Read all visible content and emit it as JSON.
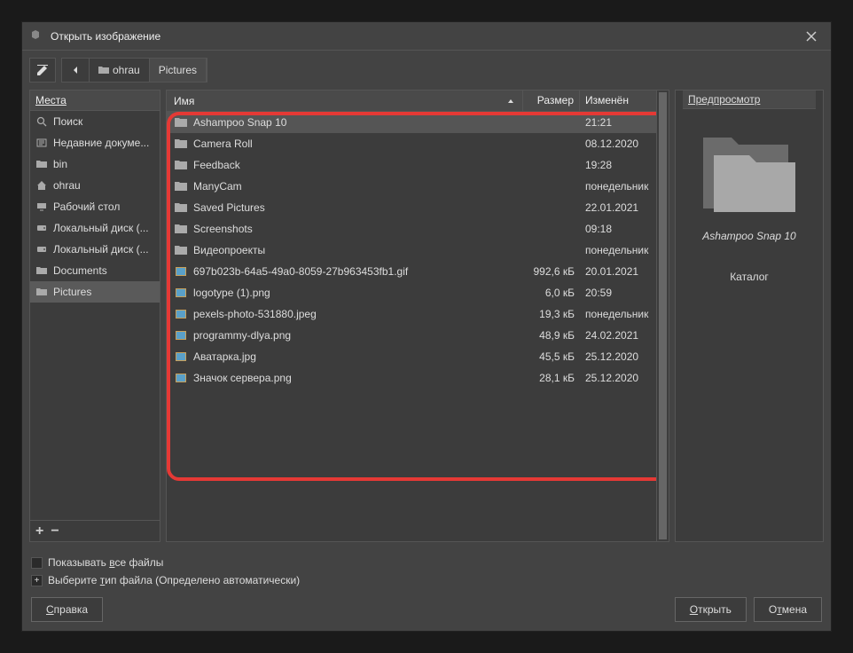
{
  "title": "Открыть изображение",
  "toolbar": {
    "path": [
      "ohrau",
      "Pictures"
    ]
  },
  "places": {
    "header": "Места",
    "items": [
      {
        "icon": "search",
        "label": "Поиск"
      },
      {
        "icon": "recent",
        "label": "Недавние докуме..."
      },
      {
        "icon": "folder",
        "label": "bin"
      },
      {
        "icon": "home",
        "label": "ohrau"
      },
      {
        "icon": "desktop",
        "label": "Рабочий стол"
      },
      {
        "icon": "disk",
        "label": "Локальный диск (..."
      },
      {
        "icon": "disk",
        "label": "Локальный диск (..."
      },
      {
        "icon": "folder",
        "label": "Documents"
      },
      {
        "icon": "folder",
        "label": "Pictures",
        "selected": true
      }
    ]
  },
  "columns": {
    "name": "Имя",
    "size": "Размер",
    "modified": "Изменён"
  },
  "files": [
    {
      "type": "folder",
      "name": "Ashampoo Snap 10",
      "size": "",
      "modified": "21:21",
      "selected": true
    },
    {
      "type": "folder",
      "name": "Camera Roll",
      "size": "",
      "modified": "08.12.2020"
    },
    {
      "type": "folder",
      "name": "Feedback",
      "size": "",
      "modified": "19:28"
    },
    {
      "type": "folder",
      "name": "ManyCam",
      "size": "",
      "modified": "понедельник"
    },
    {
      "type": "folder",
      "name": "Saved Pictures",
      "size": "",
      "modified": "22.01.2021"
    },
    {
      "type": "folder",
      "name": "Screenshots",
      "size": "",
      "modified": "09:18"
    },
    {
      "type": "folder",
      "name": "Видеопроекты",
      "size": "",
      "modified": "понедельник"
    },
    {
      "type": "image",
      "name": "697b023b-64a5-49a0-8059-27b963453fb1.gif",
      "size": "992,6 кБ",
      "modified": "20.01.2021"
    },
    {
      "type": "image",
      "name": "logotype (1).png",
      "size": "6,0 кБ",
      "modified": "20:59"
    },
    {
      "type": "image",
      "name": "pexels-photo-531880.jpeg",
      "size": "19,3 кБ",
      "modified": "понедельник"
    },
    {
      "type": "image",
      "name": "programmy-dlya.png",
      "size": "48,9 кБ",
      "modified": "24.02.2021"
    },
    {
      "type": "image",
      "name": "Аватарка.jpg",
      "size": "45,5 кБ",
      "modified": "25.12.2020"
    },
    {
      "type": "image",
      "name": "Значок сервера.png",
      "size": "28,1 кБ",
      "modified": "25.12.2020"
    }
  ],
  "preview": {
    "header": "Предпросмотр",
    "name": "Ashampoo Snap 10",
    "type": "Каталог"
  },
  "options": {
    "show_all": "Показывать все файлы",
    "filetype_prefix": "Выберите тип файла",
    "filetype_value": "(Определено автоматически)"
  },
  "buttons": {
    "help": "Справка",
    "open": "Открыть",
    "cancel": "Отмена"
  }
}
